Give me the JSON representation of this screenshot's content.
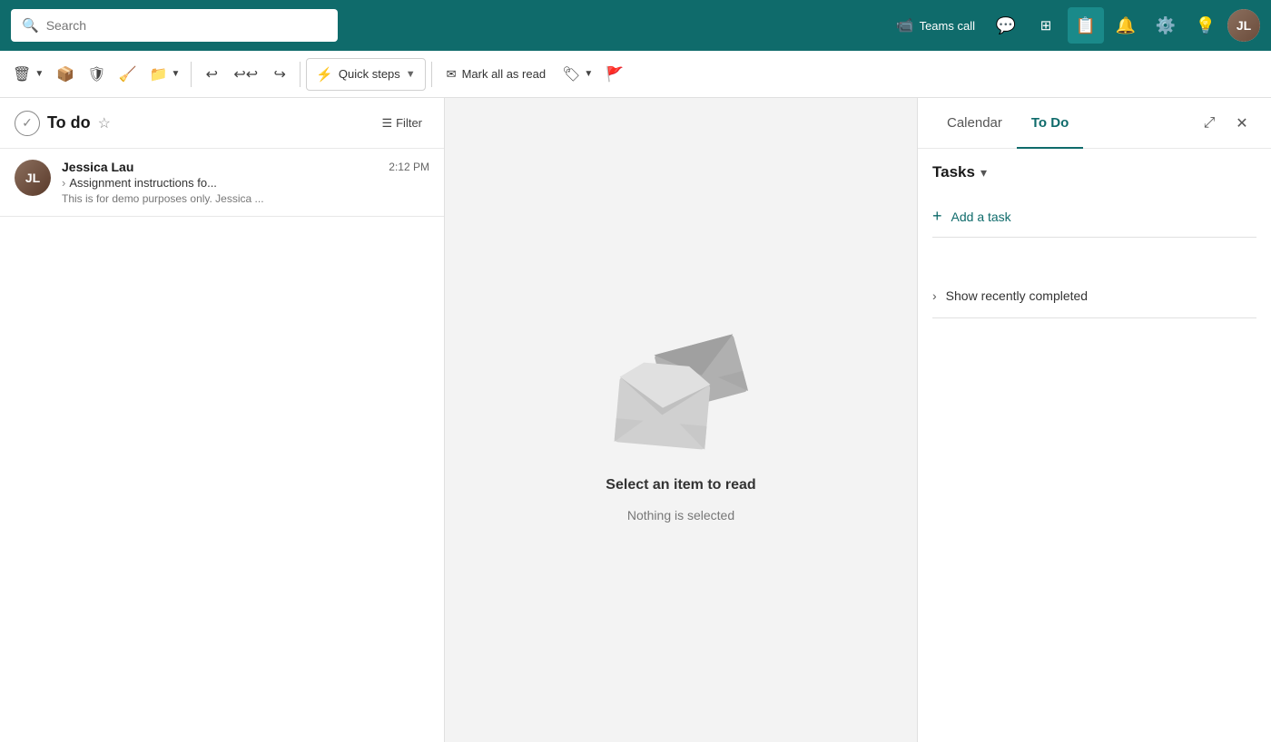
{
  "topbar": {
    "search_placeholder": "Search",
    "teams_call_label": "Teams call",
    "active_icon": "todo-icon"
  },
  "toolbar": {
    "quick_steps_label": "Quick steps",
    "mark_all_read_label": "Mark all as read"
  },
  "email_list": {
    "folder_title": "To do",
    "filter_label": "Filter",
    "email": {
      "sender": "Jessica Lau",
      "subject_prefix": "›",
      "subject": "Assignment instructions fo...",
      "time": "2:12 PM",
      "preview": "This is for demo purposes only. Jessica ..."
    }
  },
  "reading_pane": {
    "empty_title": "Select an item to read",
    "empty_sub": "Nothing is selected"
  },
  "todo_panel": {
    "calendar_tab": "Calendar",
    "todo_tab": "To Do",
    "tasks_label": "Tasks",
    "add_task_label": "Add a task",
    "show_completed_label": "Show recently completed"
  }
}
